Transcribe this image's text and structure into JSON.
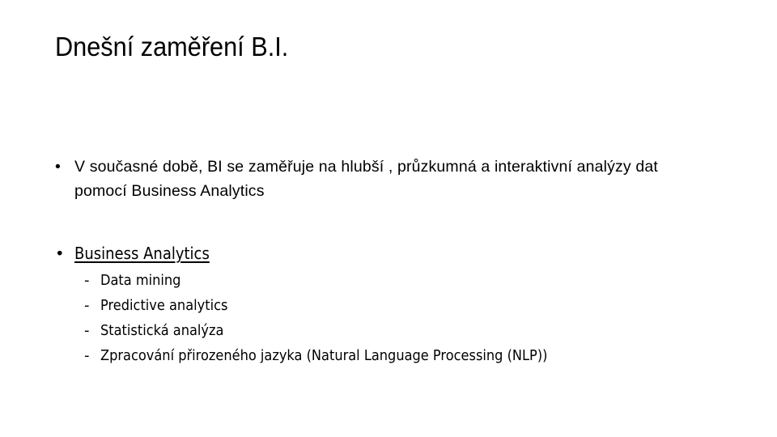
{
  "slide": {
    "background_color": "#ffffff",
    "text_color": "#000000",
    "title": "Dnešní zaměření B.I.",
    "bullet_marker": "•",
    "dash_marker": "-",
    "level1": [
      {
        "text": "V současné době, BI se zaměřuje na hlubší , průzkumná a interaktivní analýzy dat pomocí Business Analytics",
        "underline": false
      },
      {
        "text": "Business Analytics",
        "underline": true
      }
    ],
    "level2": [
      {
        "text": "Data mining"
      },
      {
        "text": "Predictive analytics"
      },
      {
        "text": "Statistická analýza"
      },
      {
        "text": "Zpracování přirozeného jazyka (Natural Language Processing (NLP))"
      }
    ]
  }
}
